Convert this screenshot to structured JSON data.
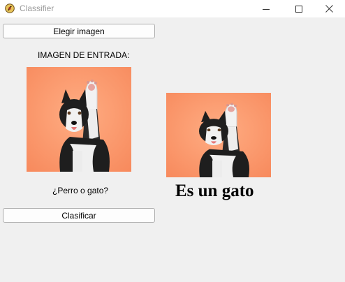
{
  "window": {
    "title": "Classifier",
    "app_icon": "python-feather-icon",
    "controls": [
      "minimize-icon",
      "maximize-icon",
      "close-icon"
    ]
  },
  "buttons": {
    "choose_image_label": "Elegir imagen",
    "classify_label": "Clasificar"
  },
  "input_section": {
    "heading": "IMAGEN DE ENTRADA:",
    "image_subject": "husky dog raising paw on orange background",
    "question": "¿Perro o gato?"
  },
  "output_section": {
    "image_subject": "husky dog raising paw on orange background",
    "result_text": "Es un gato"
  },
  "colors": {
    "window_bg": "#f0f0f0",
    "titlebar_bg": "#ffffff",
    "photo_bg": "#fb9a6e",
    "title_text": "#9a9a9a"
  }
}
